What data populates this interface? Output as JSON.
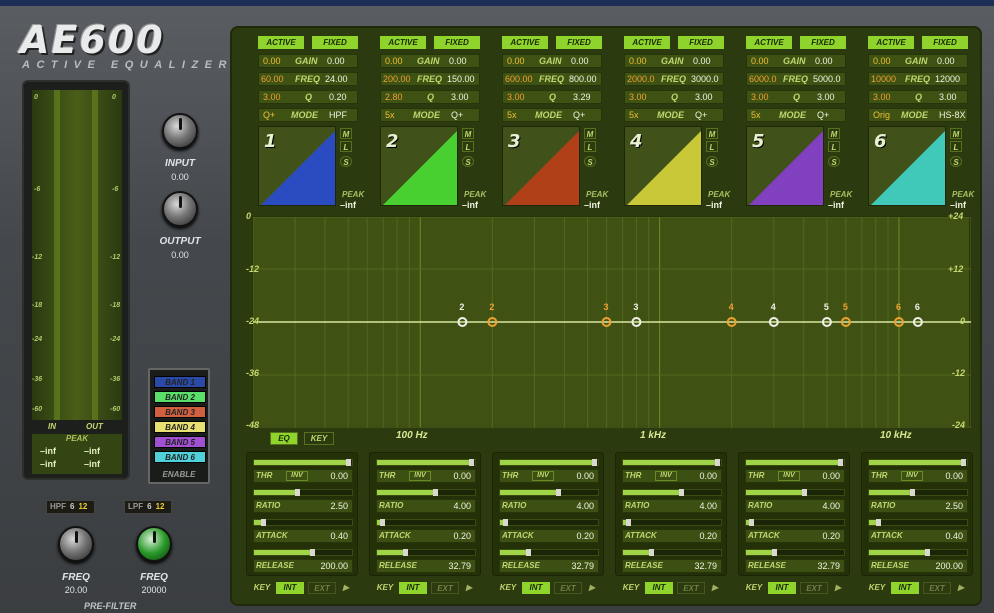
{
  "logo": {
    "title": "AE600",
    "subtitle": "ACTIVE EQUALIZER"
  },
  "meter": {
    "ticks": [
      "0",
      "-6",
      "-12",
      "-18",
      "-24",
      "-36",
      "-60"
    ],
    "in_label": "IN",
    "out_label": "OUT",
    "peak_label": "PEAK",
    "peak_values": [
      "–inf",
      "–inf",
      "–inf",
      "–inf"
    ]
  },
  "input": {
    "label": "INPUT",
    "value": "0.00"
  },
  "output": {
    "label": "OUTPUT",
    "value": "0.00"
  },
  "legend": {
    "items": [
      {
        "label": "BAND 1",
        "color": "#2a4aa8"
      },
      {
        "label": "BAND 2",
        "color": "#5ae06a"
      },
      {
        "label": "BAND 3",
        "color": "#d06040"
      },
      {
        "label": "BAND 4",
        "color": "#e8e070"
      },
      {
        "label": "BAND 5",
        "color": "#a050d0"
      },
      {
        "label": "BAND 6",
        "color": "#50d0d8"
      }
    ],
    "enable": "ENABLE"
  },
  "prefilter": {
    "title": "PRE-FILTER",
    "hpf": {
      "tag": "HPF",
      "opt1": "6",
      "opt2": "12",
      "label": "FREQ",
      "value": "20.00"
    },
    "lpf": {
      "tag": "LPF",
      "opt1": "6",
      "opt2": "12",
      "label": "FREQ",
      "value": "20000"
    }
  },
  "labels": {
    "active": "ACTIVE",
    "fixed": "FIXED",
    "gain": "GAIN",
    "freq": "FREQ",
    "q": "Q",
    "mode": "MODE",
    "peak": "PEAK",
    "m": "M",
    "l": "L",
    "s": "S"
  },
  "bands": [
    {
      "num": "1",
      "gain_l": "0.00",
      "gain_r": "0.00",
      "freq_l": "60.00",
      "freq_r": "24.00",
      "q_l": "3.00",
      "q_r": "0.20",
      "mode_l": "Q+",
      "mode_r": "HPF",
      "peak": "–inf",
      "color": "#2a4cc0"
    },
    {
      "num": "2",
      "gain_l": "0.00",
      "gain_r": "0.00",
      "freq_l": "200.00",
      "freq_r": "150.00",
      "q_l": "2.80",
      "q_r": "3.00",
      "mode_l": "5x",
      "mode_r": "Q+",
      "peak": "–inf",
      "color": "#48d030"
    },
    {
      "num": "3",
      "gain_l": "0.00",
      "gain_r": "0.00",
      "freq_l": "600.00",
      "freq_r": "800.00",
      "q_l": "3.00",
      "q_r": "3.29",
      "mode_l": "5x",
      "mode_r": "Q+",
      "peak": "–inf",
      "color": "#b04018"
    },
    {
      "num": "4",
      "gain_l": "0.00",
      "gain_r": "0.00",
      "freq_l": "2000.0",
      "freq_r": "3000.0",
      "q_l": "3.00",
      "q_r": "3.00",
      "mode_l": "5x",
      "mode_r": "Q+",
      "peak": "–inf",
      "color": "#c8c838"
    },
    {
      "num": "5",
      "gain_l": "0.00",
      "gain_r": "0.00",
      "freq_l": "6000.0",
      "freq_r": "5000.0",
      "q_l": "3.00",
      "q_r": "3.00",
      "mode_l": "5x",
      "mode_r": "Q+",
      "peak": "–inf",
      "color": "#8040c0"
    },
    {
      "num": "6",
      "gain_l": "0.00",
      "gain_r": "0.00",
      "freq_l": "10000",
      "freq_r": "12000",
      "q_l": "3.00",
      "q_r": "3.00",
      "mode_l": "Orig",
      "mode_r": "HS-8X",
      "peak": "–inf",
      "color": "#40c8b8"
    }
  ],
  "graph": {
    "left_ticks": [
      "0",
      "-12",
      "-24",
      "-36",
      "-48"
    ],
    "right_ticks": [
      "+24",
      "+12",
      "0",
      "-12",
      "-24"
    ],
    "freq_labels": [
      "100 Hz",
      "1 kHz",
      "10 kHz"
    ],
    "eq_tab": "EQ",
    "key_tab": "KEY",
    "nodes": [
      "2",
      "2",
      "3",
      "3",
      "4",
      "4",
      "5",
      "5",
      "6",
      "6"
    ]
  },
  "dyn_labels": {
    "thr": "THR",
    "inv": "INV",
    "ratio": "RATIO",
    "attack": "ATTACK",
    "release": "RELEASE",
    "key": "KEY",
    "int": "INT",
    "ext": "EXT"
  },
  "dynamics": [
    {
      "thr": "0.00",
      "ratio": "2.50",
      "attack": "0.40",
      "release": "200.00",
      "thr_fill": 0.97,
      "ratio_fill": 0.45,
      "attack_fill": 0.1,
      "release_fill": 0.6
    },
    {
      "thr": "0.00",
      "ratio": "4.00",
      "attack": "0.20",
      "release": "32.79",
      "thr_fill": 0.97,
      "ratio_fill": 0.6,
      "attack_fill": 0.06,
      "release_fill": 0.3
    },
    {
      "thr": "0.00",
      "ratio": "4.00",
      "attack": "0.20",
      "release": "32.79",
      "thr_fill": 0.97,
      "ratio_fill": 0.6,
      "attack_fill": 0.06,
      "release_fill": 0.3
    },
    {
      "thr": "0.00",
      "ratio": "4.00",
      "attack": "0.20",
      "release": "32.79",
      "thr_fill": 0.97,
      "ratio_fill": 0.6,
      "attack_fill": 0.06,
      "release_fill": 0.3
    },
    {
      "thr": "0.00",
      "ratio": "4.00",
      "attack": "0.20",
      "release": "32.79",
      "thr_fill": 0.97,
      "ratio_fill": 0.6,
      "attack_fill": 0.06,
      "release_fill": 0.3
    },
    {
      "thr": "0.00",
      "ratio": "2.50",
      "attack": "0.40",
      "release": "200.00",
      "thr_fill": 0.97,
      "ratio_fill": 0.45,
      "attack_fill": 0.1,
      "release_fill": 0.6
    }
  ]
}
